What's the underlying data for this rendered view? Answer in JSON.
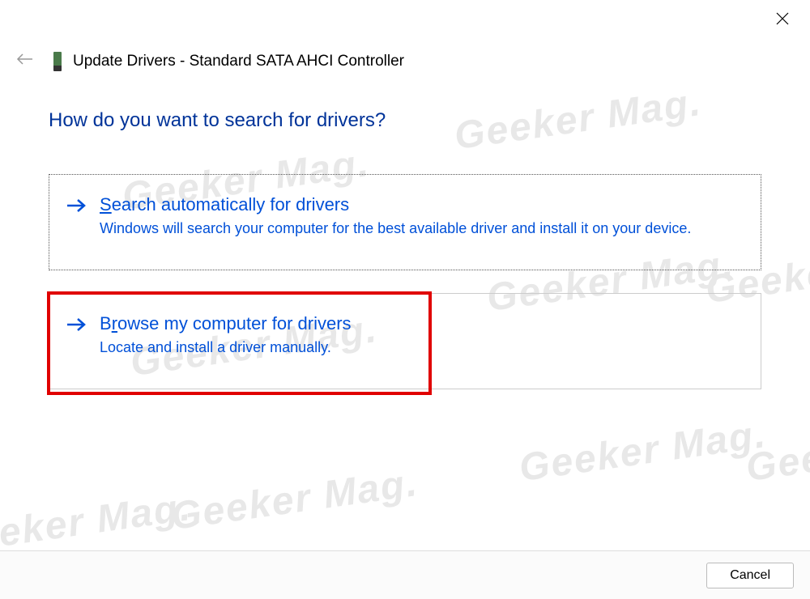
{
  "header": {
    "title": "Update Drivers - Standard SATA AHCI Controller"
  },
  "question": "How do you want to search for drivers?",
  "options": [
    {
      "title_pre": "",
      "title_underline": "S",
      "title_post": "earch automatically for drivers",
      "description": "Windows will search your computer for the best available driver and install it on your device."
    },
    {
      "title_pre": "B",
      "title_underline": "r",
      "title_post": "owse my computer for drivers",
      "description": "Locate and install a driver manually."
    }
  ],
  "footer": {
    "cancel_label": "Cancel"
  },
  "watermark_text": "Geeker Mag."
}
